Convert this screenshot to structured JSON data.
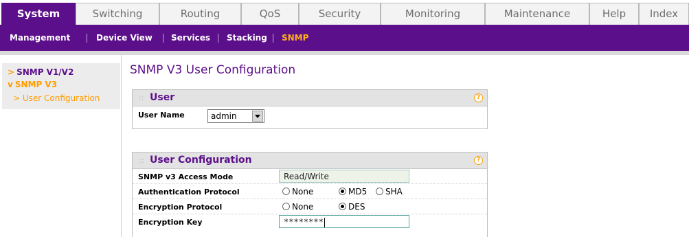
{
  "top_tabs": [
    {
      "label": "System",
      "active": true
    },
    {
      "label": "Switching"
    },
    {
      "label": "Routing"
    },
    {
      "label": "QoS"
    },
    {
      "label": "Security"
    },
    {
      "label": "Monitoring"
    },
    {
      "label": "Maintenance"
    },
    {
      "label": "Help"
    },
    {
      "label": "Index"
    }
  ],
  "sub_nav": [
    {
      "label": "Management"
    },
    {
      "label": "Device View"
    },
    {
      "label": "Services"
    },
    {
      "label": "Stacking"
    },
    {
      "label": "SNMP",
      "current": true
    }
  ],
  "left_nav": {
    "items": [
      {
        "label": "SNMP V1/V2",
        "marker": ">"
      },
      {
        "label": "SNMP V3",
        "marker": "v"
      }
    ],
    "sub_items": [
      {
        "label": "> User Configuration"
      }
    ]
  },
  "page_title": "SNMP V3 User Configuration",
  "user_box": {
    "title": "User",
    "help_icon": "?",
    "user_name_label": "User Name",
    "user_name_value": "admin"
  },
  "config_box": {
    "title": "User Configuration",
    "help_icon": "?",
    "access_mode_label": "SNMP v3 Access Mode",
    "access_mode_value": "Read/Write",
    "auth_label": "Authentication Protocol",
    "auth_options": [
      "None",
      "MD5",
      "SHA"
    ],
    "auth_selected": "MD5",
    "enc_label": "Encryption Protocol",
    "enc_options": [
      "None",
      "DES"
    ],
    "enc_selected": "DES",
    "key_label": "Encryption Key",
    "key_value": "********"
  },
  "colors": {
    "brand_purple": "#5b0f8a",
    "accent_orange": "#ff9c00"
  }
}
